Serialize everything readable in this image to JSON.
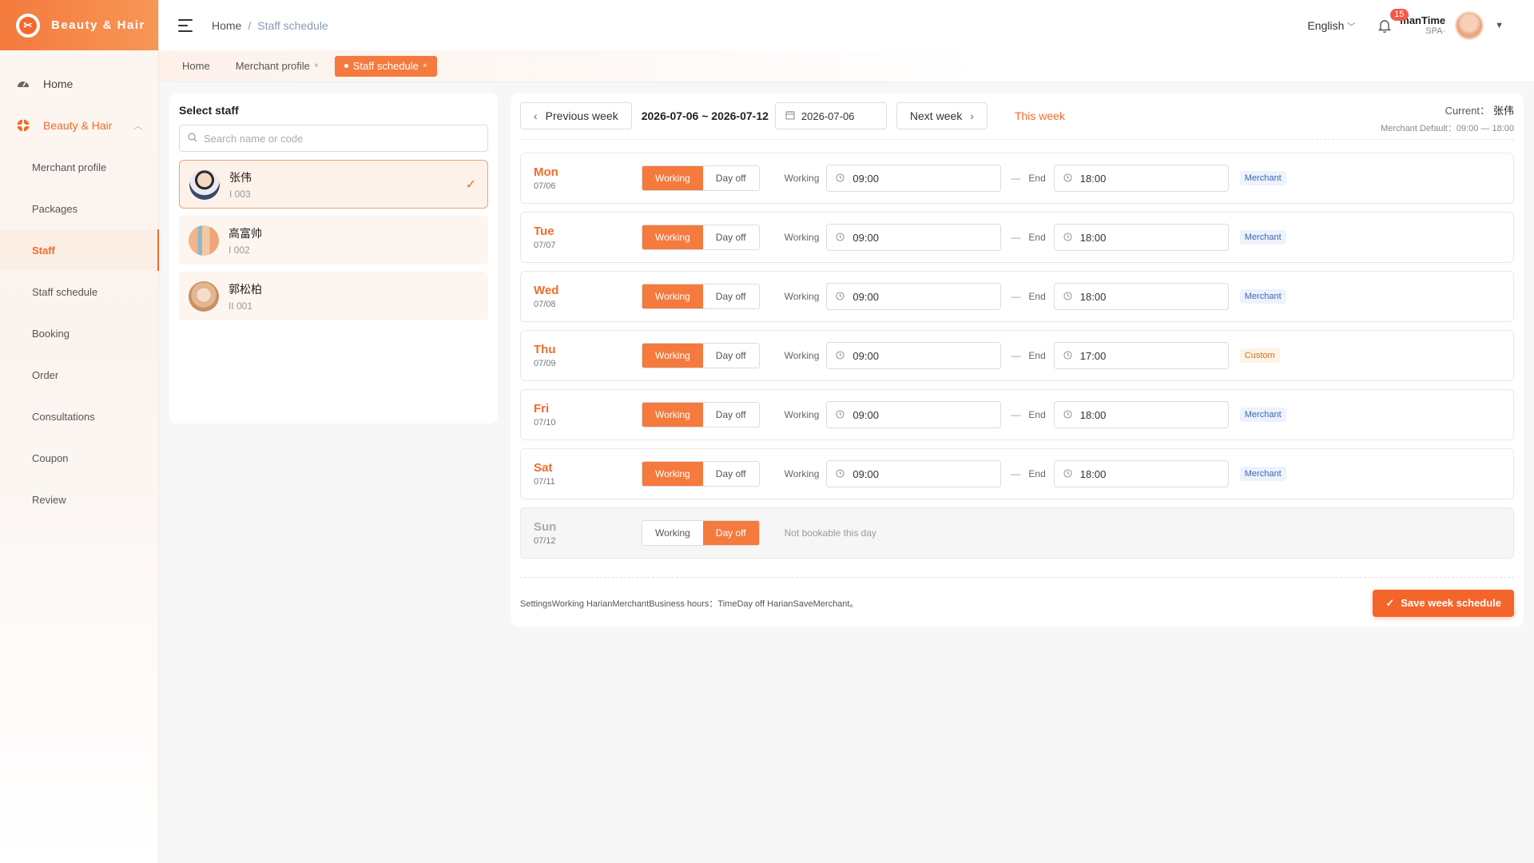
{
  "app": {
    "brand": "Beauty & Hair"
  },
  "colors": {
    "accent": "#f26b2a",
    "merchant_tag": "#3a68b5",
    "custom_tag": "#c6761f"
  },
  "sidebar": {
    "home": "Home",
    "group": "Beauty & Hair",
    "items": [
      {
        "label": "Merchant profile"
      },
      {
        "label": "Packages"
      },
      {
        "label": "Staff"
      },
      {
        "label": "Staff schedule"
      },
      {
        "label": "Booking"
      },
      {
        "label": "Order"
      },
      {
        "label": "Consultations"
      },
      {
        "label": "Coupon"
      },
      {
        "label": "Review"
      }
    ],
    "active_item": "Staff"
  },
  "header": {
    "breadcrumb": [
      "Home",
      "Staff schedule"
    ],
    "language": "English",
    "notif_count": "15",
    "user_name": "manTime",
    "user_sub": "SPA·"
  },
  "tabs": [
    {
      "label": "Home"
    },
    {
      "label": "Merchant profile"
    },
    {
      "label": "Staff schedule"
    }
  ],
  "staff_panel": {
    "title": "Select staff",
    "search_placeholder": "Search name or code",
    "staff": [
      {
        "name": "张伟",
        "code": "I 003",
        "selected": true
      },
      {
        "name": "高富帅",
        "code": "I 002",
        "selected": false
      },
      {
        "name": "郭松柏",
        "code": "II 001",
        "selected": false
      }
    ]
  },
  "schedule": {
    "prev_label": "Previous week",
    "range": "2026-07-06 ~ 2026-07-12",
    "date": "2026-07-06",
    "next_label": "Next week",
    "this_week": "This week",
    "current_label": "Current：",
    "current_name": "张伟",
    "merchant_default": "Merchant Default：09:00 — 18:00",
    "working_label": "Working",
    "dayoff_label": "Day off",
    "end_label": "End",
    "days": [
      {
        "day": "Mon",
        "date": "07/06",
        "start": "09:00",
        "end": "18:00",
        "tag": "Merchant",
        "tag_type": "merchant"
      },
      {
        "day": "Tue",
        "date": "07/07",
        "start": "09:00",
        "end": "18:00",
        "tag": "Merchant",
        "tag_type": "merchant"
      },
      {
        "day": "Wed",
        "date": "07/08",
        "start": "09:00",
        "end": "18:00",
        "tag": "Merchant",
        "tag_type": "merchant"
      },
      {
        "day": "Thu",
        "date": "07/09",
        "start": "09:00",
        "end": "17:00",
        "tag": "Custom",
        "tag_type": "custom"
      },
      {
        "day": "Fri",
        "date": "07/10",
        "start": "09:00",
        "end": "18:00",
        "tag": "Merchant",
        "tag_type": "merchant"
      },
      {
        "day": "Sat",
        "date": "07/11",
        "start": "09:00",
        "end": "18:00",
        "tag": "Merchant",
        "tag_type": "merchant"
      },
      {
        "day": "Sun",
        "date": "07/12",
        "off": true,
        "note": "Not bookable this day"
      }
    ],
    "footer_note": "SettingsWorking HarianMerchantBusiness hours：TimeDay off HarianSaveMerchant。",
    "save_label": "Save week schedule"
  }
}
